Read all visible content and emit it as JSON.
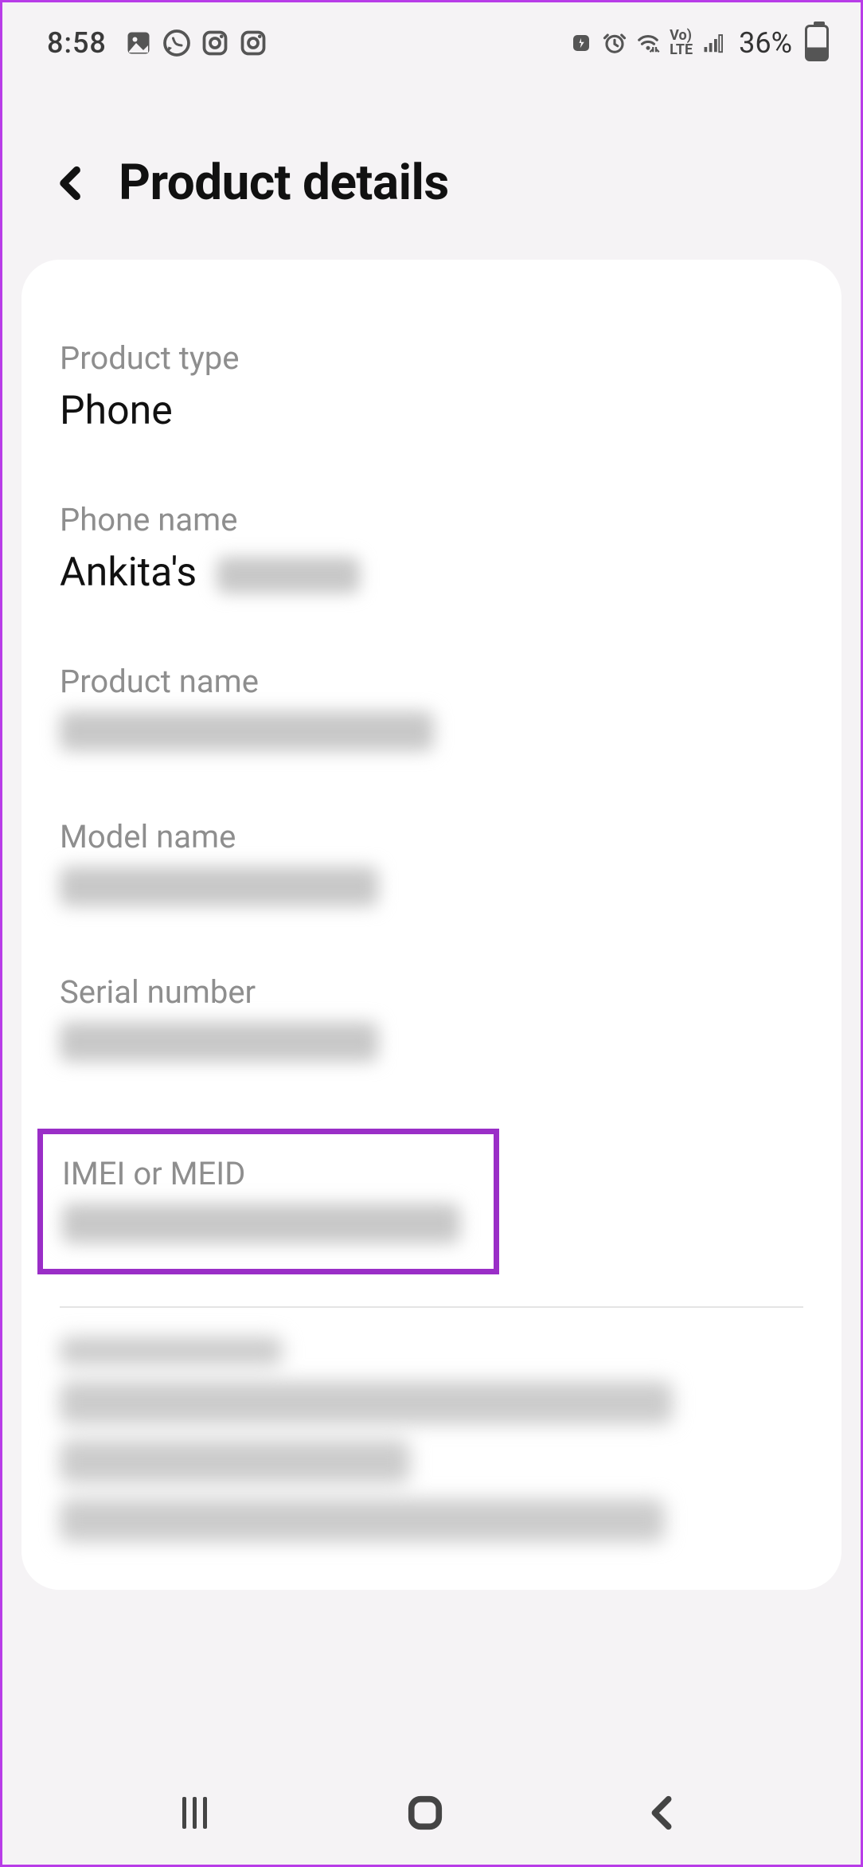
{
  "status": {
    "time": "8:58",
    "battery": "36%",
    "icons_left": [
      "gallery-icon",
      "whatsapp-icon",
      "instagram-icon",
      "instagram-icon"
    ],
    "icons_right": [
      "focus-icon",
      "alarm-icon",
      "wifi-icon",
      "volte-icon",
      "signal-icon"
    ]
  },
  "header": {
    "title": "Product details"
  },
  "details": {
    "product_type": {
      "label": "Product type",
      "value": "Phone"
    },
    "phone_name": {
      "label": "Phone name",
      "value": "Ankita's"
    },
    "product_name": {
      "label": "Product name",
      "value": ""
    },
    "model_name": {
      "label": "Model name",
      "value": ""
    },
    "serial": {
      "label": "Serial number",
      "value": ""
    },
    "imei": {
      "label": "IMEI or MEID",
      "value": ""
    }
  },
  "highlight": "imei"
}
